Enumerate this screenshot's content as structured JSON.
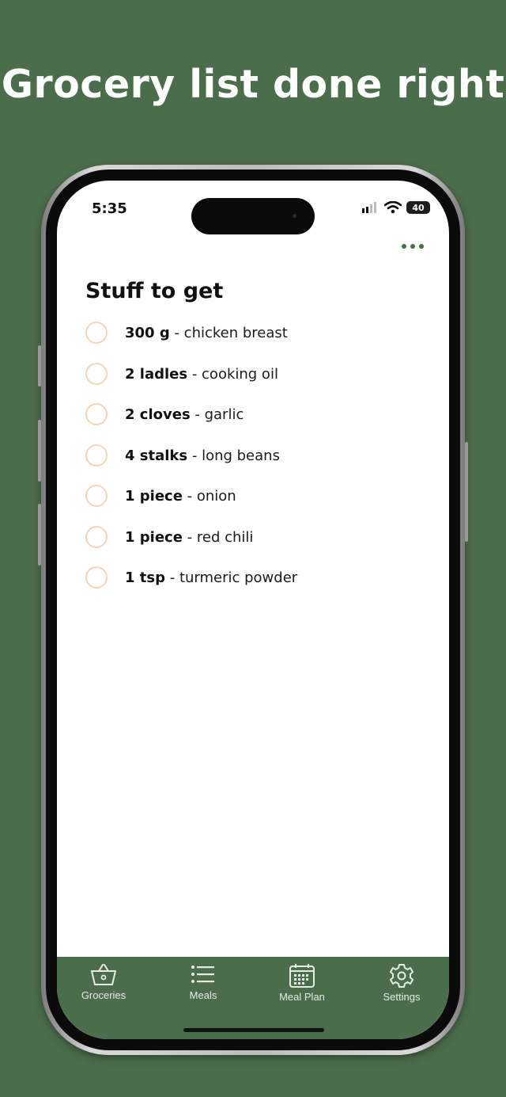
{
  "headline": "Grocery list done right",
  "status": {
    "time": "5:35",
    "battery": "40"
  },
  "list": {
    "title": "Stuff to get",
    "items": [
      {
        "qty": "300 g",
        "name": " - chicken breast"
      },
      {
        "qty": "2 ladles",
        "name": " - cooking oil"
      },
      {
        "qty": "2 cloves",
        "name": " - garlic"
      },
      {
        "qty": "4 stalks",
        "name": " - long beans"
      },
      {
        "qty": "1 piece",
        "name": " - onion"
      },
      {
        "qty": "1 piece",
        "name": " - red chili"
      },
      {
        "qty": "1 tsp",
        "name": " - turmeric powder"
      }
    ]
  },
  "tabs": [
    {
      "label": "Groceries",
      "icon": "basket-icon"
    },
    {
      "label": "Meals",
      "icon": "list-icon"
    },
    {
      "label": "Meal Plan",
      "icon": "calendar-icon"
    },
    {
      "label": "Settings",
      "icon": "gear-icon"
    }
  ],
  "colors": {
    "background": "#4b6d4b",
    "accent": "#4b6d4b",
    "checkbox": "#f6d4b6"
  }
}
